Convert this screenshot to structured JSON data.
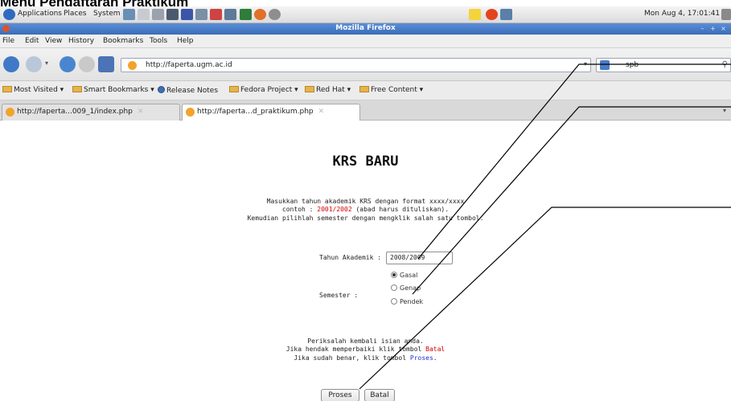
{
  "doc": {
    "title": "Menu Pendaftaran Praktikum"
  },
  "panel": {
    "applications": "Applications",
    "places": "Places",
    "system": "System",
    "clock": "Mon Aug  4, 17:01:41"
  },
  "window": {
    "title": "Mozilla Firefox"
  },
  "menubar": [
    "File",
    "Edit",
    "View",
    "History",
    "Bookmarks",
    "Tools",
    "Help"
  ],
  "nav": {
    "url": "http://faperta.ugm.ac.id",
    "search_value": "spb"
  },
  "bookmarks": [
    "Most Visited",
    "Smart Bookmarks",
    "Release Notes",
    "Fedora Project",
    "Red Hat",
    "Free Content"
  ],
  "tabs": [
    {
      "label": "http://faperta...009_1/index.php"
    },
    {
      "label": "http://faperta...d_praktikum.php"
    }
  ],
  "page": {
    "heading": "KRS BARU",
    "intro_line1": "Masukkan tahun akademik KRS dengan format xxxx/xxxx",
    "intro_line2_pre": "contoh : ",
    "intro_line2_example": "2001/2002",
    "intro_line2_post": " (abad harus dituliskan).",
    "intro_line3": "Kemudian pilihlah semester dengan mengklik salah satu tombol.",
    "tahun_label": "Tahun Akademik :",
    "tahun_value": "2008/2009",
    "semester_label": "Semester :",
    "semester_options": [
      "Gasal",
      "Genap",
      "Pendek"
    ],
    "semester_selected": "Gasal",
    "check_line1": "Periksalah kembali isian anda.",
    "check_line2_pre": "Jika hendak memperbaiki klik tombol ",
    "check_line2_link": "Batal",
    "check_line3_pre": "Jika sudah benar, klik tombol ",
    "check_line3_link": "Proses",
    "check_line3_post": ".",
    "proses_button": "Proses",
    "batal_button": "Batal"
  },
  "colors": {
    "accent_red": "#d40000",
    "accent_blue": "#2233d4",
    "titlebar": "#3a6cb9"
  }
}
